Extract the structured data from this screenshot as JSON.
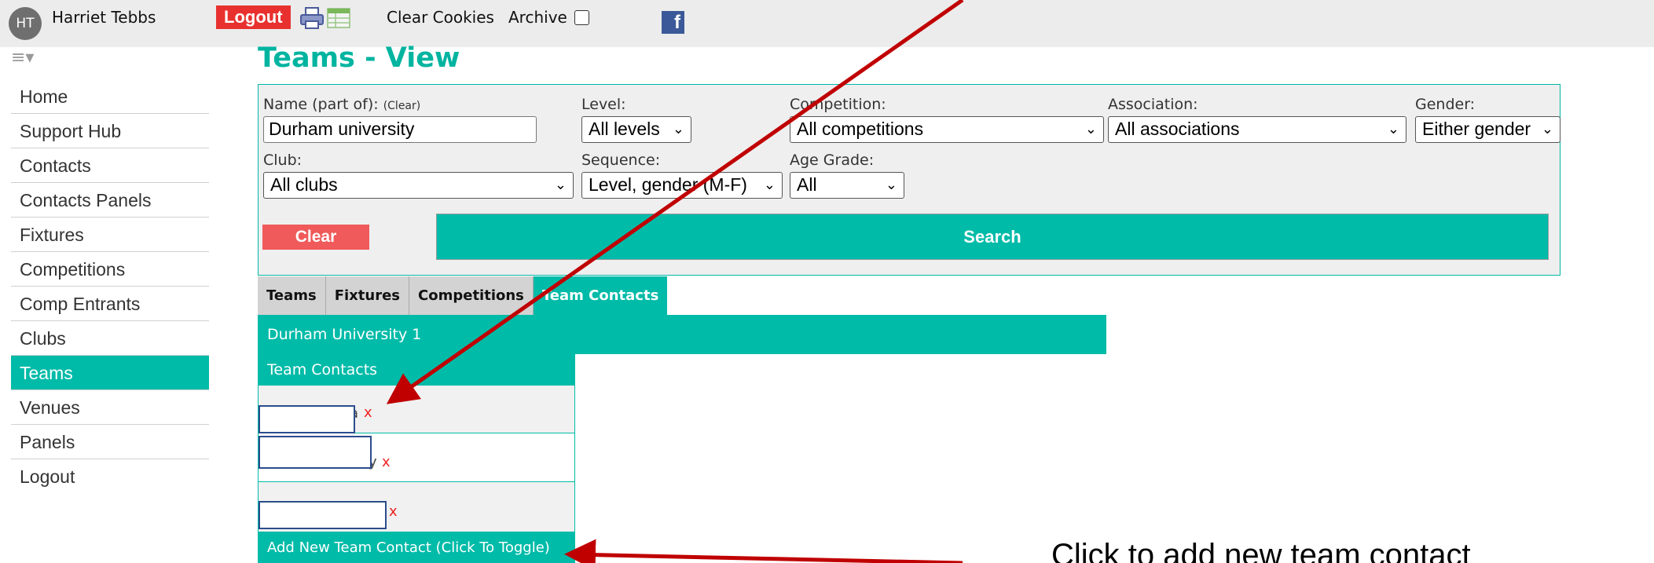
{
  "topbar": {
    "avatar_initials": "HT",
    "user_name": "Harriet Tebbs",
    "logout_label": "Logout",
    "clear_cookies_label": "Clear Cookies",
    "archive_label": "Archive",
    "archive_checked": false,
    "facebook_glyph": "f"
  },
  "sidebar": {
    "menu_glyph": "≡▾",
    "items": [
      {
        "label": "Home"
      },
      {
        "label": "Support Hub"
      },
      {
        "label": "Contacts"
      },
      {
        "label": "Contacts Panels"
      },
      {
        "label": "Fixtures"
      },
      {
        "label": "Competitions"
      },
      {
        "label": "Comp Entrants"
      },
      {
        "label": "Clubs"
      },
      {
        "label": "Teams",
        "active": true
      },
      {
        "label": "Venues"
      },
      {
        "label": "Panels"
      },
      {
        "label": "Logout"
      }
    ]
  },
  "page": {
    "title": "Teams - View"
  },
  "filters": {
    "name_label": "Name (part of):",
    "name_clear": "(Clear)",
    "name_value": "Durham university",
    "level_label": "Level:",
    "level_value": "All levels",
    "competition_label": "Competition:",
    "competition_value": "All competitions",
    "association_label": "Association:",
    "association_value": "All associations",
    "gender_label": "Gender:",
    "gender_value": "Either gender",
    "club_label": "Club:",
    "club_value": "All clubs",
    "sequence_label": "Sequence:",
    "sequence_value": "Level, gender (M-F)",
    "age_label": "Age Grade:",
    "age_value": "All",
    "clear_label": "Clear",
    "search_label": "Search"
  },
  "tabs": [
    {
      "label": "Teams"
    },
    {
      "label": "Fixtures"
    },
    {
      "label": "Competitions"
    },
    {
      "label": "Team Contacts",
      "active": true
    }
  ],
  "team": {
    "name": "Durham University 1",
    "contacts_header": "Team Contacts",
    "contacts": [
      {
        "partial_name": "a",
        "delete": "x"
      },
      {
        "partial_name": "y",
        "delete": "x"
      },
      {
        "partial_name": "",
        "delete": "x"
      }
    ],
    "add_label": "Add New Team Contact (Click To Toggle)"
  },
  "annotation": {
    "text": "Click to add new team contact"
  },
  "colors": {
    "accent": "#00bba8",
    "logout": "#e8312f",
    "clear": "#f05a5a",
    "arrow": "#c00000"
  }
}
